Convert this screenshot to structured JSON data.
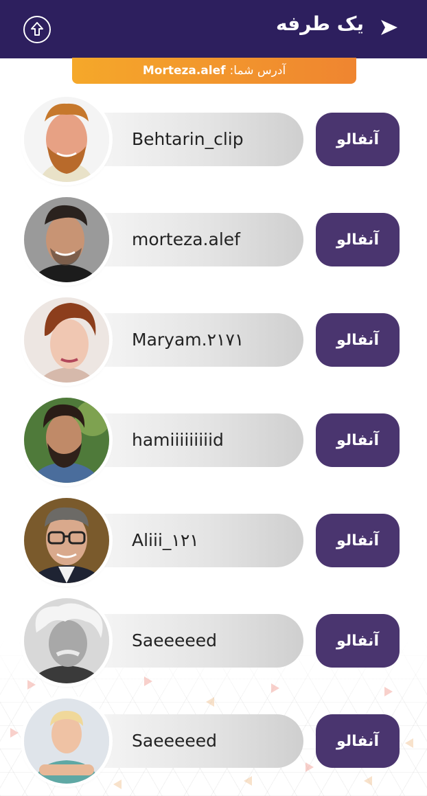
{
  "header": {
    "title": "یک طرفه",
    "bg_color": "#2d1f5e"
  },
  "address": {
    "label": "آدرس شما:",
    "value": "Morteza.alef"
  },
  "accent_colors": {
    "button": "#4a356f",
    "address_bar": "#f29a2d"
  },
  "users": [
    {
      "username": "Behtarin_clip",
      "action": "آنفالو",
      "avatar_icon": "man-red-beard-avatar"
    },
    {
      "username": "morteza.alef",
      "action": "آنفالو",
      "avatar_icon": "man-dark-hair-avatar"
    },
    {
      "username": "Maryam.۲۱۷۱",
      "action": "آنفالو",
      "avatar_icon": "woman-short-hair-avatar"
    },
    {
      "username": "hamiiiiiiiiid",
      "action": "آنفالو",
      "avatar_icon": "man-beard-denim-avatar"
    },
    {
      "username": "Aliii_۱۲۱",
      "action": "آنفالو",
      "avatar_icon": "man-glasses-avatar"
    },
    {
      "username": "Saeeeeed",
      "action": "آنفالو",
      "avatar_icon": "man-white-hair-avatar"
    },
    {
      "username": "Saeeeeed",
      "action": "آنفالو",
      "avatar_icon": "man-blond-avatar"
    }
  ]
}
